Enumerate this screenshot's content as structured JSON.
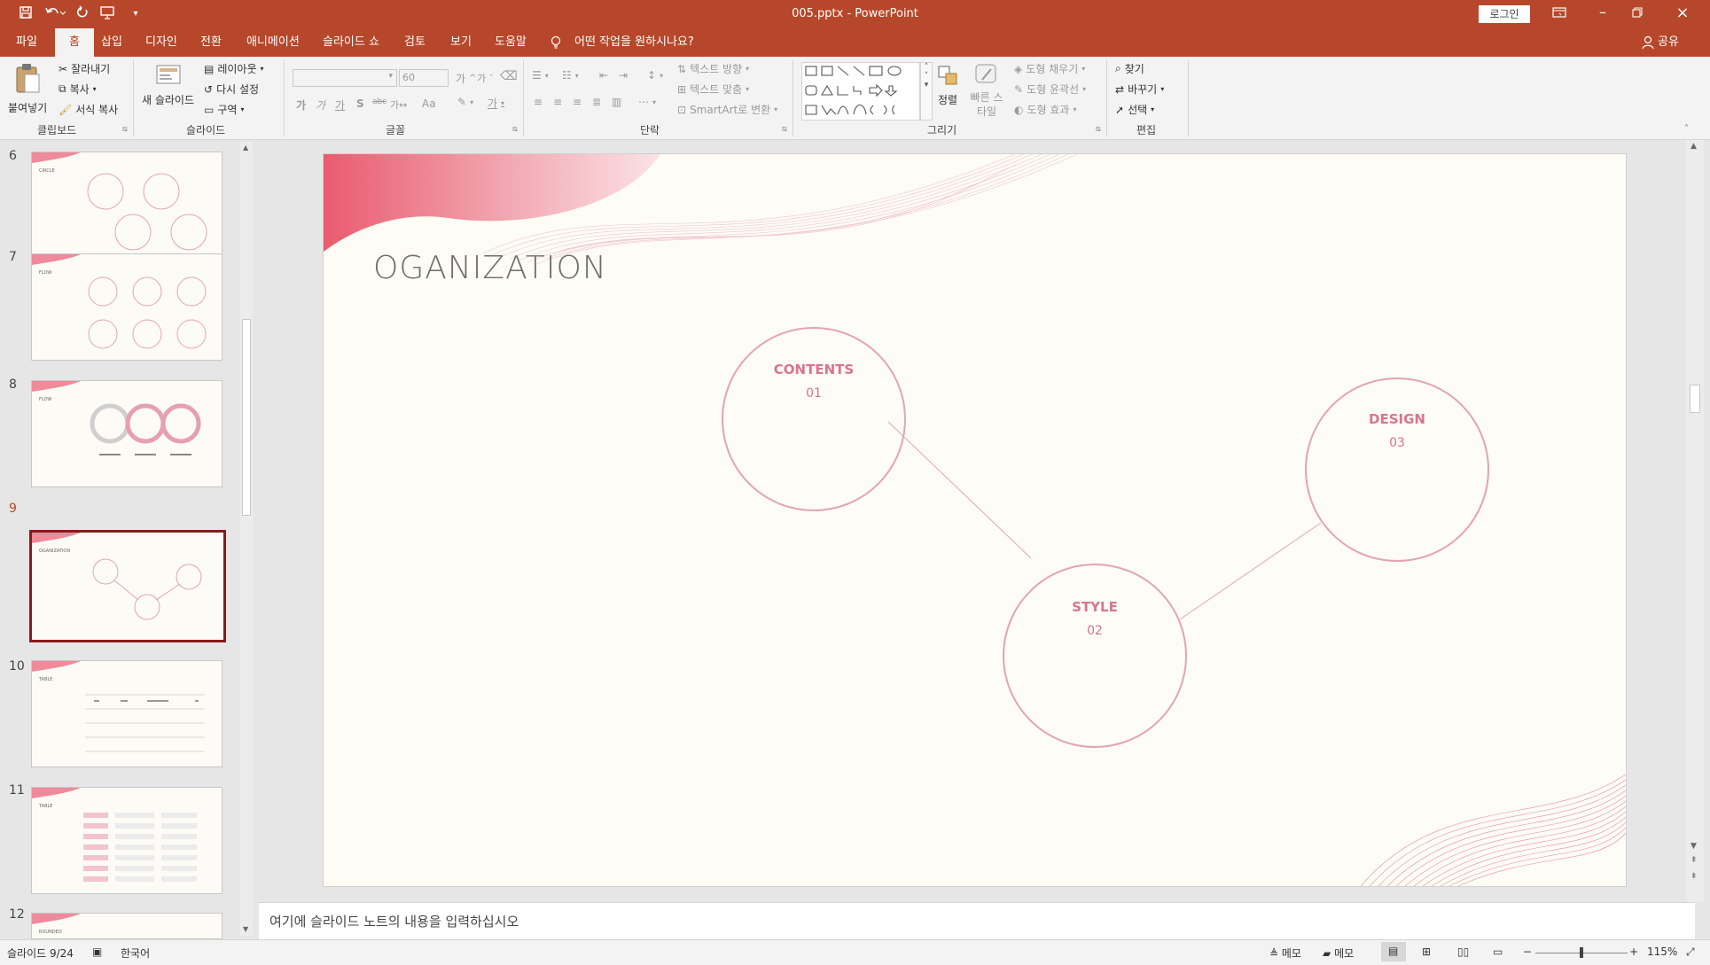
{
  "window": {
    "title": "005.pptx  -  PowerPoint",
    "login": "로그인"
  },
  "tabs": [
    "파일",
    "홈",
    "삽입",
    "디자인",
    "전환",
    "애니메이션",
    "슬라이드 쇼",
    "검토",
    "보기",
    "도움말"
  ],
  "active_tab": "홈",
  "tellme": "어떤 작업을 원하시나요?",
  "share": "공유",
  "ribbon": {
    "clipboard": {
      "paste": "붙여넣기",
      "cut": "잘라내기",
      "copy": "복사",
      "format_painter": "서식 복사",
      "label": "클립보드"
    },
    "slides": {
      "new_slide": "새 슬라이드",
      "layout": "레이아웃",
      "reset": "다시 설정",
      "section": "구역",
      "label": "슬라이드"
    },
    "font": {
      "size": "60",
      "label": "글꼴",
      "case": "Aa",
      "bold": "가",
      "italic": "가",
      "underline": "가",
      "shadow": "S",
      "strike": "abc",
      "spacing": "가↔"
    },
    "paragraph": {
      "text_direction": "텍스트 방향",
      "align_text": "텍스트 맞춤",
      "smartart": "SmartArt로 변환",
      "label": "단락"
    },
    "drawing": {
      "arrange": "정렬",
      "quick_styles": "빠른 스타일",
      "fill": "도형 채우기",
      "outline": "도형 윤곽선",
      "effects": "도형 효과",
      "label": "그리기"
    },
    "editing": {
      "find": "찾기",
      "replace": "바꾸기",
      "select": "선택",
      "label": "편집"
    }
  },
  "thumbnails": [
    {
      "num": "6",
      "title": "CIRCLE"
    },
    {
      "num": "7",
      "title": "FLOW"
    },
    {
      "num": "8",
      "title": "FLOW"
    },
    {
      "num": "9",
      "title": "OGANIZATION"
    },
    {
      "num": "10",
      "title": "TABLE"
    },
    {
      "num": "11",
      "title": "TABLE"
    },
    {
      "num": "12",
      "title": "ROUNDED"
    }
  ],
  "selected_thumb": "9",
  "slide": {
    "title": "OGANIZATION",
    "nodes": [
      {
        "label": "CONTENTS",
        "num": "01"
      },
      {
        "label": "STYLE",
        "num": "02"
      },
      {
        "label": "DESIGN",
        "num": "03"
      }
    ]
  },
  "notes_placeholder": "여기에 슬라이드 노트의 내용을 입력하십시오",
  "status": {
    "slide": "슬라이드 9/24",
    "language": "한국어",
    "notes": "메모",
    "comments": "메모",
    "zoom": "115%"
  },
  "colors": {
    "accent": "#b7472a",
    "slide_pink": "#d9758f",
    "circle_stroke": "#e2a5b4"
  }
}
